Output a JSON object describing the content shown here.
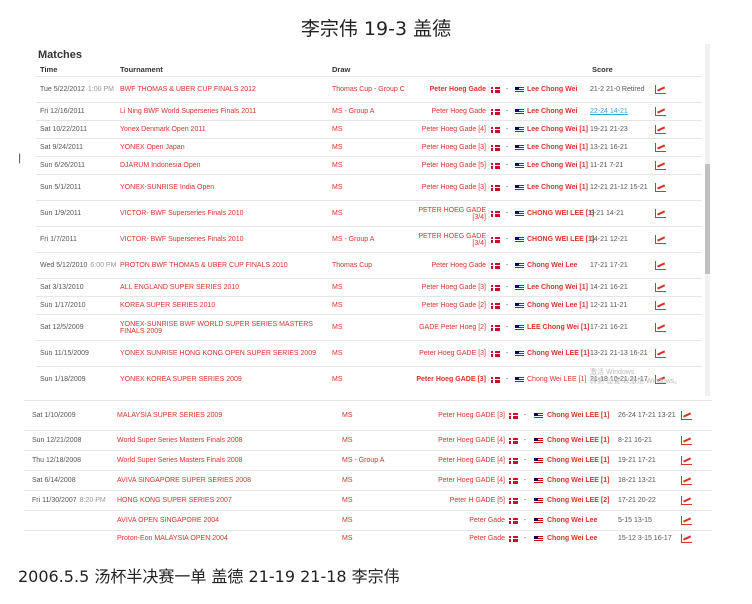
{
  "heading": "李宗伟 19-3 盖德",
  "footer": "2006.5.5 汤杯半决赛一单 盖德 21-19 21-18 李宗伟",
  "side_mark": "|",
  "panel1": {
    "title": "Matches",
    "columns": {
      "time": "Time",
      "tournament": "Tournament",
      "draw": "Draw",
      "score": "Score"
    },
    "watermark_line1": "激活 Windows",
    "watermark_line2": "转到\"设置\"以激活 Windows。",
    "rows": [
      {
        "time": "Tue 5/22/2012",
        "time_extra": "1:00 PM",
        "tournament": "BWF THOMAS & UBER CUP FINALS 2012",
        "draw": "Thomas Cup - Group C",
        "player1": "Peter Hoeg Gade",
        "player2": "Lee Chong Wei",
        "score": "21-2 21-0 Retired"
      },
      {
        "time": "Fri 12/16/2011",
        "time_extra": "",
        "tournament": "Li Ning BWF World Superseries Finals 2011",
        "draw": "MS - Group A",
        "player1": "Peter Hoeg Gade",
        "player2": "Lee Chong Wei",
        "score": "22-24 14-21"
      },
      {
        "time": "Sat 10/22/2011",
        "time_extra": "",
        "tournament": "Yonex Denmark Open 2011",
        "draw": "MS",
        "player1": "Peter Hoeg Gade [4]",
        "player2": "Lee Chong Wei [1]",
        "score": "19-21 21-23"
      },
      {
        "time": "Sat 9/24/2011",
        "time_extra": "",
        "tournament": "YONEX Open Japan",
        "draw": "MS",
        "player1": "Peter Hoeg Gade [3]",
        "player2": "Lee Chong Wei [1]",
        "score": "13-21 16-21"
      },
      {
        "time": "Sun 6/26/2011",
        "time_extra": "",
        "tournament": "DJARUM Indonesia Open",
        "draw": "MS",
        "player1": "Peter Hoeg Gade [5]",
        "player2": "Lee Chong Wei [1]",
        "score": "11-21 7-21"
      },
      {
        "time": "Sun 5/1/2011",
        "time_extra": "",
        "tournament": "YONEX-SUNRISE India Open",
        "draw": "MS",
        "player1": "Peter Hoeg Gade [3]",
        "player2": "Lee Chong Wei [1]",
        "score": "12-21 21-12 15-21"
      },
      {
        "time": "Sun 1/9/2011",
        "time_extra": "",
        "tournament": "VICTOR- BWF Superseries Finals 2010",
        "draw": "MS",
        "player1": "PETER HOEG GADE [3/4]",
        "player2": "CHONG WEI LEE [1]",
        "score": "9-21 14-21"
      },
      {
        "time": "Fri 1/7/2011",
        "time_extra": "",
        "tournament": "VICTOR- BWF Superseries Finals 2010",
        "draw": "MS - Group A",
        "player1": "PETER HOEG GADE [3/4]",
        "player2": "CHONG WEI LEE [1]",
        "score": "14-21 12-21"
      },
      {
        "time": "Wed 5/12/2010",
        "time_extra": "6:00 PM",
        "tournament": "PROTON BWF THOMAS & UBER CUP FINALS 2010",
        "draw": "Thomas Cup",
        "player1": "Peter Hoeg Gade",
        "player2": "Chong Wei Lee",
        "score": "17-21 17-21"
      },
      {
        "time": "Sat 3/13/2010",
        "time_extra": "",
        "tournament": "ALL ENGLAND SUPER SERIES 2010",
        "draw": "MS",
        "player1": "Peter Hoeg Gade [3]",
        "player2": "Lee Chong Wei [1]",
        "score": "14-21 16-21"
      },
      {
        "time": "Sun 1/17/2010",
        "time_extra": "",
        "tournament": "KOREA SUPER SERIES 2010",
        "draw": "MS",
        "player1": "Peter Hoeg Gade [2]",
        "player2": "Chong Wei Lee [1]",
        "score": "12-21 11-21"
      },
      {
        "time": "Sat 12/5/2009",
        "time_extra": "",
        "tournament": "YONEX-SUNRISE BWF WORLD SUPER SERIES MASTERS FINALS 2009",
        "draw": "MS",
        "player1": "GADE Peter Hoeg [2]",
        "player2": "LEE Chong Wei [1]",
        "score": "17-21 16-21"
      },
      {
        "time": "Sun 11/15/2009",
        "time_extra": "",
        "tournament": "YONEX SUNRISE HONG KONG OPEN SUPER SERIES 2009",
        "draw": "MS",
        "player1": "Peter Hoeg GADE [3]",
        "player2": "Chong Wei LEE [1]",
        "score": "13-21 21-13 16-21"
      },
      {
        "time": "Sun 1/18/2009",
        "time_extra": "",
        "tournament": "YONEX KOREA SUPER SERIES 2009",
        "draw": "MS",
        "player1": "Peter Hoeg GADE [3]",
        "player2": "Chong Wei LEE [1]",
        "score": "21-18 10-21 21-17"
      }
    ]
  },
  "panel2": {
    "rows": [
      {
        "time": "Sat 1/10/2009",
        "time_extra": "",
        "tournament": "MALAYSIA SUPER SERIES 2009",
        "draw": "MS",
        "player1": "Peter Hoeg GADE [3]",
        "player2": "Chong Wei LEE [1]",
        "score": "26-24 17-21 13-21"
      },
      {
        "time": "Sun 12/21/2008",
        "time_extra": "",
        "tournament": "World Super Series Masters Finals 2008",
        "draw": "MS",
        "player1": "Peter Hoeg GADE [4]",
        "player2": "Chong Wei LEE [1]",
        "score": "8-21 16-21"
      },
      {
        "time": "Thu 12/18/2008",
        "time_extra": "",
        "tournament": "World Super Series Masters Finals 2008",
        "draw": "MS - Group A",
        "player1": "Peter Hoeg GADE [4]",
        "player2": "Chong Wei LEE [1]",
        "score": "19-21 17-21"
      },
      {
        "time": "Sat 6/14/2008",
        "time_extra": "",
        "tournament": "AVIVA SINGAPORE SUPER SERIES 2008",
        "draw": "MS",
        "player1": "Peter Hoeg GADE [4]",
        "player2": "Chong Wei LEE [1]",
        "score": "18-21 13-21"
      },
      {
        "time": "Fri 11/30/2007",
        "time_extra": "8:20 PM",
        "tournament": "HONG KONG SUPER SERIES 2007",
        "draw": "MS",
        "player1": "Peter H GADE [5]",
        "player2": "Chong Wei LEE [2]",
        "score": "17-21 20-22"
      },
      {
        "time": "",
        "time_extra": "",
        "tournament": "AVIVA OPEN SINGAPORE 2004",
        "draw": "MS",
        "player1": "Peter Gade",
        "player2": "Chong Wei Lee",
        "score": "5-15 13-15"
      },
      {
        "time": "",
        "time_extra": "",
        "tournament": "Proton-Eon MALAYSIA OPEN 2004",
        "draw": "MS",
        "player1": "Peter Gade",
        "player2": "Chong Wei Lee",
        "score": "15-12 3-15 16-17"
      }
    ]
  },
  "icons": {
    "flag_left": "denmark-flag-icon",
    "flag_right": "malaysia-flag-icon",
    "chart": "h2h-chart-icon"
  },
  "colors": {
    "link_red": "#d9342b",
    "score_link_blue": "#3aa0d8"
  }
}
